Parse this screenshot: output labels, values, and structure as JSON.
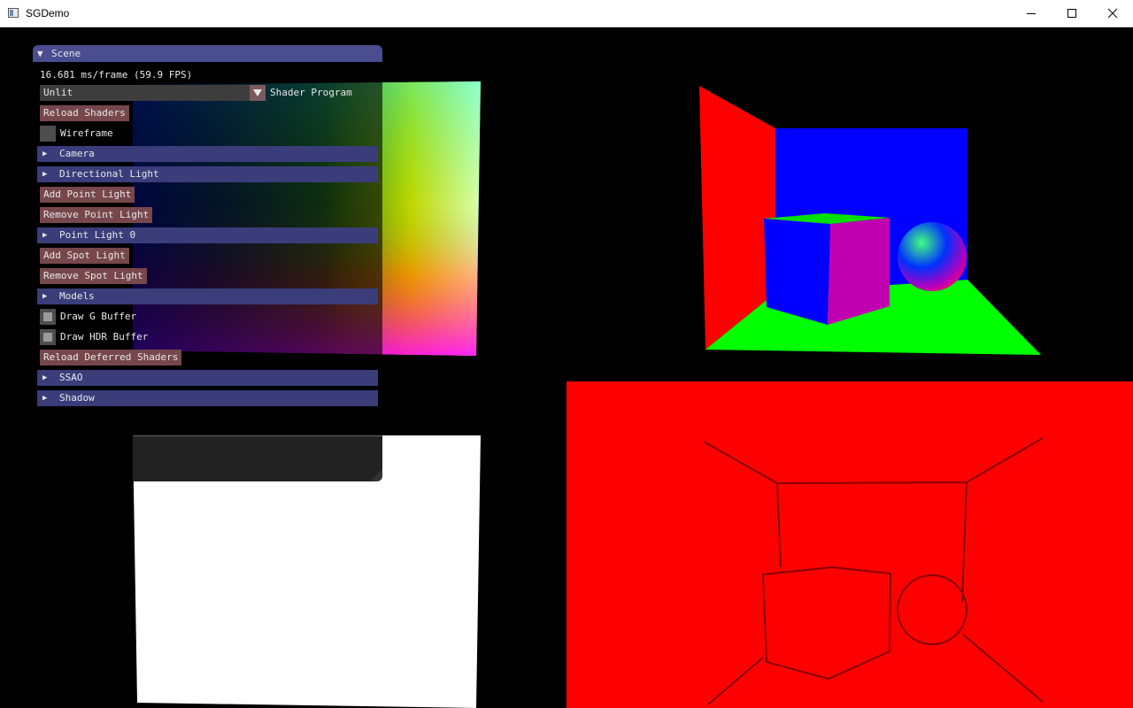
{
  "window": {
    "title": "SGDemo",
    "controls": [
      "minimize-icon",
      "maximize-icon",
      "close-icon"
    ]
  },
  "panel": {
    "title": "Scene",
    "fps_text": "16.681 ms/frame (59.9 FPS)",
    "shader_combo": {
      "value": "Unlit",
      "label": "Shader Program"
    },
    "reload_shaders": "Reload Shaders",
    "wireframe": {
      "label": "Wireframe",
      "checked": false
    },
    "camera": "Camera",
    "directional_light": "Directional Light",
    "add_point_light": "Add Point Light",
    "remove_point_light": "Remove Point Light",
    "point_light_0": "Point Light 0",
    "add_spot_light": "Add Spot Light",
    "remove_spot_light": "Remove Spot Light",
    "models": "Models",
    "draw_g_buffer": {
      "label": "Draw G Buffer",
      "checked": true
    },
    "draw_hdr_buffer": {
      "label": "Draw HDR Buffer",
      "checked": true
    },
    "reload_deferred_shaders": "Reload Deferred Shaders",
    "ssao": "SSAO",
    "shadow": "Shadow"
  },
  "colors": {
    "header": "#3a3d7a",
    "title_bar": "#4a4d8f",
    "button": "#76474b",
    "scene_red": "#ff0000",
    "scene_green": "#00ff00",
    "scene_blue": "#0000ff"
  }
}
